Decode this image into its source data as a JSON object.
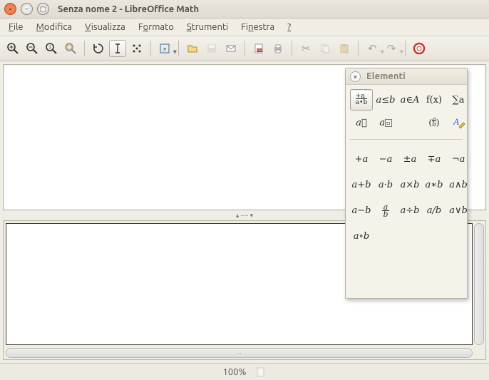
{
  "window": {
    "title": "Senza nome 2 - LibreOffice Math"
  },
  "menu": {
    "file": "File",
    "edit": "Modifica",
    "view": "Visualizza",
    "format": "Formato",
    "tools": "Strumenti",
    "window": "Finestra",
    "help": "?"
  },
  "status": {
    "zoom": "100%"
  },
  "elements": {
    "title": "Elementi",
    "cats": {
      "unary": "+a⁄a•b",
      "rel": "a≤b",
      "setops": "a∈A",
      "func": "f(x)",
      "sum": "∑a",
      "attr": "a⃗",
      "brack": "aᶠ",
      "format": "(a⁄b)",
      "format_color": "#2e6fbf"
    },
    "ops": {
      "r1": [
        "+a",
        "−a",
        "±a",
        "∓a",
        "¬a"
      ],
      "r2": [
        "a+b",
        "a·b",
        "a×b",
        "a∗b",
        "a∧b"
      ],
      "r3": [
        "a−b",
        "a⁄b",
        "a÷b",
        "a/b",
        "a∨b"
      ],
      "r4": [
        "a∘b"
      ]
    }
  }
}
